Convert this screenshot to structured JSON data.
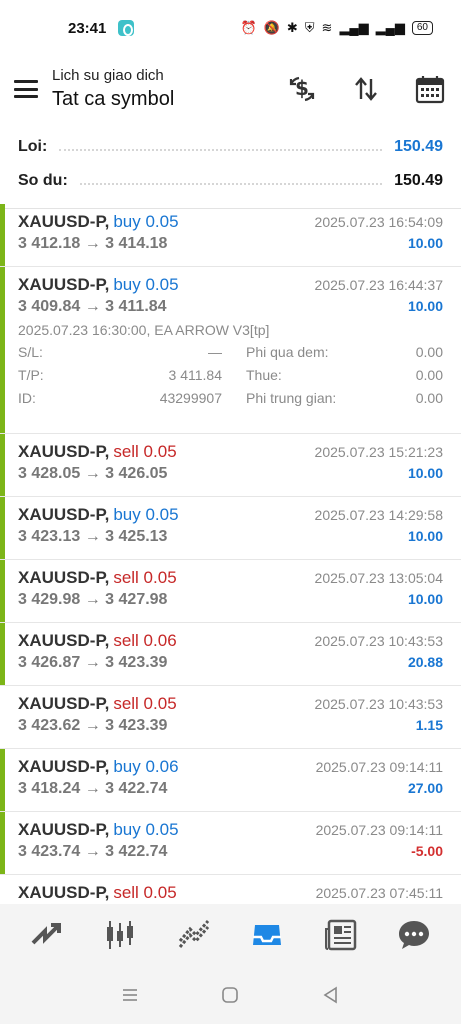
{
  "status_bar": {
    "time": "23:41",
    "battery": "60"
  },
  "header": {
    "subtitle": "Lich su giao dich",
    "title": "Tat ca symbol",
    "icons": [
      "currency-exchange-icon",
      "sort-icon",
      "calendar-icon"
    ]
  },
  "summary": {
    "profit_label": "Loi:",
    "profit_value": "150.49",
    "balance_label": "So du:",
    "balance_value": "150.49"
  },
  "deals": [
    {
      "symbol": "XAUUSD-P,",
      "side": "buy",
      "volume": "0.05",
      "side_text": "buy 0.05",
      "prices": "3 412.18 → 3 414.18",
      "time": "2025.07.23 16:54:09",
      "profit": "10.00"
    },
    {
      "symbol": "XAUUSD-P,",
      "side": "buy",
      "volume": "0.05",
      "side_text": "buy 0.05",
      "prices": "3 409.84 → 3 411.84",
      "time": "2025.07.23 16:44:37",
      "profit": "10.00",
      "details": {
        "comment": "2025.07.23 16:30:00, EA ARROW V3[tp]",
        "sl_label": "S/L:",
        "sl_value": "—",
        "tp_label": "T/P:",
        "tp_value": "3 411.84",
        "id_label": "ID:",
        "id_value": "43299907",
        "swap_label": "Phi qua dem:",
        "swap_value": "0.00",
        "tax_label": "Thue:",
        "tax_value": "0.00",
        "fee_label": "Phi trung gian:",
        "fee_value": "0.00"
      }
    },
    {
      "symbol": "XAUUSD-P,",
      "side": "sell",
      "volume": "0.05",
      "side_text": "sell 0.05",
      "prices": "3 428.05 → 3 426.05",
      "time": "2025.07.23 15:21:23",
      "profit": "10.00"
    },
    {
      "symbol": "XAUUSD-P,",
      "side": "buy",
      "volume": "0.05",
      "side_text": "buy 0.05",
      "prices": "3 423.13 → 3 425.13",
      "time": "2025.07.23 14:29:58",
      "profit": "10.00"
    },
    {
      "symbol": "XAUUSD-P,",
      "side": "sell",
      "volume": "0.05",
      "side_text": "sell 0.05",
      "prices": "3 429.98 → 3 427.98",
      "time": "2025.07.23 13:05:04",
      "profit": "10.00"
    },
    {
      "symbol": "XAUUSD-P,",
      "side": "sell",
      "volume": "0.06",
      "side_text": "sell 0.06",
      "prices": "3 426.87 → 3 423.39",
      "time": "2025.07.23 10:43:53",
      "profit": "20.88"
    },
    {
      "symbol": "XAUUSD-P,",
      "side": "sell",
      "volume": "0.05",
      "side_text": "sell 0.05",
      "prices": "3 423.62 → 3 423.39",
      "time": "2025.07.23 10:43:53",
      "profit": "1.15"
    },
    {
      "symbol": "XAUUSD-P,",
      "side": "buy",
      "volume": "0.06",
      "side_text": "buy 0.06",
      "prices": "3 418.24 → 3 422.74",
      "time": "2025.07.23 09:14:11",
      "profit": "27.00"
    },
    {
      "symbol": "XAUUSD-P,",
      "side": "buy",
      "volume": "0.05",
      "side_text": "buy 0.05",
      "prices": "3 423.74 → 3 422.74",
      "time": "2025.07.23 09:14:11",
      "profit": "-5.00"
    },
    {
      "symbol": "XAUUSD-P,",
      "side": "sell",
      "volume": "0.05",
      "side_text": "sell 0.05",
      "prices": "",
      "time": "2025.07.23 07:45:11",
      "profit": ""
    }
  ],
  "tabs": [
    "quotes-icon",
    "chart-icon",
    "trade-icon",
    "history-icon",
    "news-icon",
    "chat-icon"
  ],
  "active_tab": "history-icon",
  "colors": {
    "accent": "#1976d2",
    "buy": "#1976d2",
    "sell": "#c62828",
    "bar": "#7cb518",
    "negative": "#d32f2f"
  }
}
